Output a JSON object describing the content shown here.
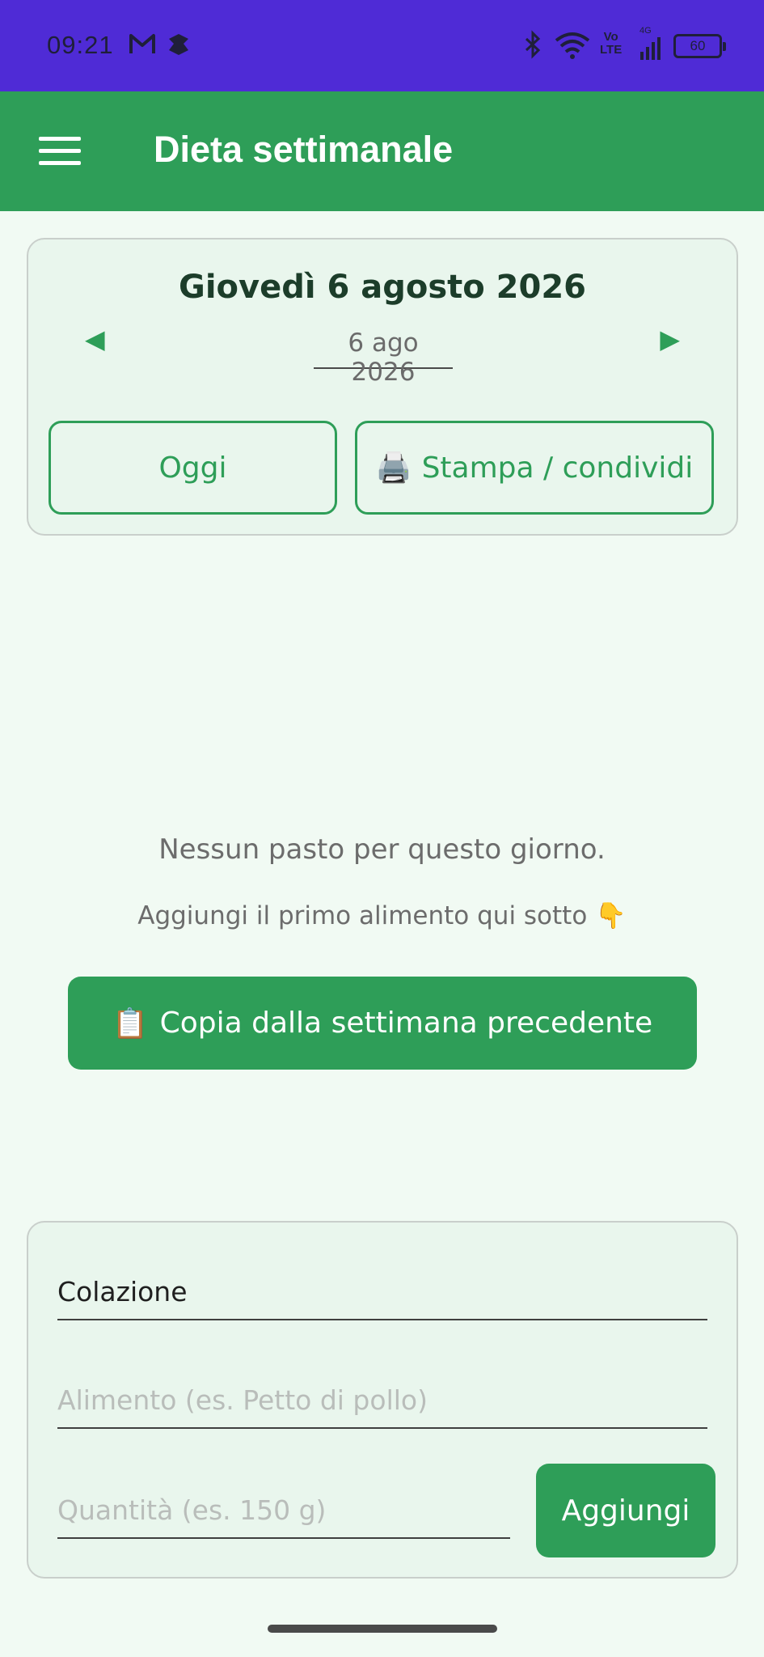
{
  "status_bar": {
    "time": "09:21",
    "icons": [
      "gmail-icon",
      "app-icon",
      "bluetooth-icon",
      "wifi-icon",
      "volte-icon",
      "signal-icon"
    ],
    "volte_top": "Vo",
    "volte_bottom": "LTE",
    "network": "4G",
    "battery": "60"
  },
  "app_bar": {
    "title": "Dieta settimanale",
    "menu_icon": "hamburger-icon"
  },
  "date_nav": {
    "full_date": "Giovedì 6 agosto 2026",
    "short_date": "6 ago 2026",
    "prev_icon": "◀",
    "next_icon": "▶",
    "today_label": "Oggi",
    "print_icon": "🖨️",
    "print_label": "Stampa / condividi"
  },
  "empty_state": {
    "message": "Nessun pasto per questo giorno.",
    "hint": "Aggiungi il primo alimento qui sotto 👇",
    "copy_icon": "📋",
    "copy_label": "Copia dalla settimana precedente"
  },
  "add_form": {
    "meal_value": "Colazione",
    "food_placeholder": "Alimento (es. Petto di pollo)",
    "quantity_placeholder": "Quantità (es. 150 g)",
    "add_label": "Aggiungi"
  },
  "colors": {
    "status_bar": "#4f2bd6",
    "accent": "#2e9e58",
    "background": "#f1faf3",
    "card": "#e9f6ed"
  }
}
